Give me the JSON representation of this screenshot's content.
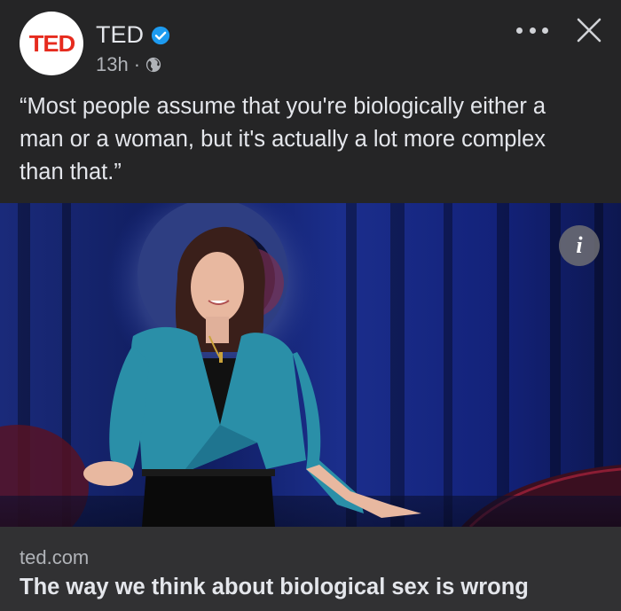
{
  "header": {
    "avatar_text": "TED",
    "page_name": "TED",
    "timestamp": "13h",
    "separator": "·",
    "verified_icon": "verified-badge-icon",
    "privacy_icon": "globe-icon",
    "more_icon": "ellipsis-icon",
    "close_icon": "close-icon"
  },
  "caption": {
    "lines": [
      "“Most people assume that you're biologically either a",
      "man or a woman, but it's actually a lot more complex",
      "than that.”"
    ]
  },
  "media": {
    "info_label": "i",
    "info_icon": "info-icon"
  },
  "link_preview": {
    "domain": "ted.com",
    "title": "The way we think about biological sex is wrong"
  },
  "colors": {
    "background": "#252526",
    "link_box": "#313133",
    "ted_red": "#e62b1e",
    "verified_blue": "#1d9bf0",
    "text_primary": "#e4e6eb",
    "text_secondary": "#b0b3b8"
  }
}
